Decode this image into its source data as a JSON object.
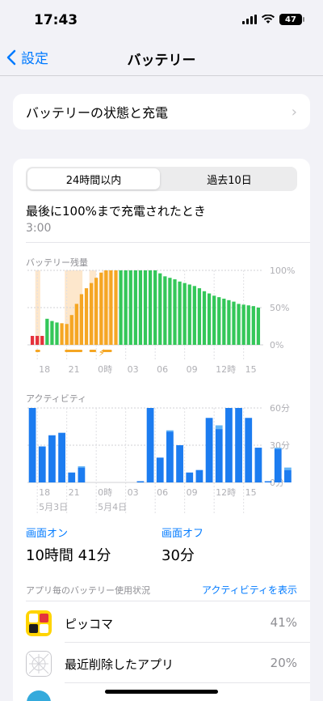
{
  "status": {
    "time": "17:43",
    "battery": "47"
  },
  "nav": {
    "back_label": "設定",
    "title": "バッテリー"
  },
  "health": {
    "label": "バッテリーの状態と充電"
  },
  "segment": {
    "tab_24h": "24時間以内",
    "tab_10d": "過去10日"
  },
  "last_charge": {
    "label": "最後に100%まで充電されたとき",
    "time": "3:00"
  },
  "battery_chart": {
    "title": "バッテリー残量",
    "y_ticks": [
      "100%",
      "50%",
      "0%"
    ],
    "x_ticks": [
      "18",
      "21",
      "0時",
      "03",
      "06",
      "09",
      "12時",
      "15"
    ]
  },
  "activity_chart": {
    "title": "アクティビティ",
    "y_ticks": [
      "60分",
      "30分",
      "0分"
    ],
    "x_ticks": [
      "18",
      "21",
      "0時",
      "03",
      "06",
      "09",
      "12時",
      "15"
    ],
    "dates": [
      "5月3日",
      "5月4日"
    ]
  },
  "screen": {
    "on_label": "画面オン",
    "on_value": "10時間 41分",
    "off_label": "画面オフ",
    "off_value": "30分"
  },
  "usage": {
    "header": "アプリ毎のバッテリー使用状況",
    "link": "アクティビティを表示"
  },
  "apps": [
    {
      "name": "ピッコマ",
      "percent": "41%"
    },
    {
      "name": "最近削除したアプリ",
      "percent": "20%"
    }
  ],
  "chart_data": [
    {
      "type": "bar",
      "title": "バッテリー残量",
      "ylabel": "%",
      "ylim": [
        0,
        100
      ],
      "x_ticks": [
        "18",
        "21",
        "0時",
        "03",
        "06",
        "09",
        "12時",
        "15"
      ],
      "hours": [
        17.5,
        18,
        18.5,
        19,
        19.5,
        20,
        20.5,
        21,
        21.5,
        22,
        22.5,
        23,
        23.5,
        24,
        24.5,
        25,
        25.5,
        26,
        26.5,
        27,
        27.5,
        28,
        28.5,
        29,
        29.5,
        30,
        30.5,
        31,
        31.5,
        32,
        32.5,
        33,
        33.5,
        34,
        34.5,
        35,
        35.5,
        36,
        36.5,
        37,
        37.5,
        38,
        38.5,
        39,
        39.5,
        40,
        40.5
      ],
      "values": [
        12,
        12,
        12,
        35,
        32,
        30,
        29,
        28,
        40,
        55,
        68,
        76,
        83,
        90,
        97,
        100,
        100,
        100,
        100,
        100,
        100,
        100,
        100,
        100,
        100,
        100,
        96,
        92,
        90,
        88,
        85,
        83,
        81,
        79,
        76,
        72,
        69,
        66,
        64,
        62,
        60,
        58,
        55,
        54,
        53,
        52,
        50
      ],
      "series_colors": {
        "low": "#e5323c",
        "charging": "#f5a623",
        "normal": "#34c759"
      },
      "charging_from": 20.5,
      "charging_to": 26.5,
      "low_until": 19,
      "charging_bands": [
        [
          17.8,
          18.3
        ],
        [
          20.8,
          22.6
        ],
        [
          23.3,
          24.0
        ],
        [
          24.6,
          25.6
        ]
      ]
    },
    {
      "type": "bar",
      "title": "アクティビティ",
      "ylabel": "分",
      "ylim": [
        0,
        60
      ],
      "x_ticks": [
        "18",
        "21",
        "0時",
        "03",
        "06",
        "09",
        "12時",
        "15"
      ],
      "series": [
        {
          "name": "画面オン",
          "color": "#1c7cf0",
          "values": [
            60,
            29,
            38,
            40,
            8,
            12,
            0,
            0,
            0,
            0,
            0,
            1,
            60,
            20,
            41,
            30,
            8,
            10,
            52,
            43,
            60,
            60,
            52,
            28,
            1,
            27,
            10
          ]
        },
        {
          "name": "画面オフ",
          "color": "#62b4f6",
          "values": [
            0,
            0,
            0,
            0,
            0,
            1,
            0,
            0,
            0,
            0,
            0,
            0,
            0,
            0,
            1,
            0,
            0,
            0,
            0,
            3,
            0,
            0,
            0,
            0,
            0,
            1,
            2
          ]
        }
      ],
      "x": [
        17.5,
        18.5,
        19.5,
        20.5,
        21.5,
        22.5,
        23.5,
        24.5,
        25.5,
        26.5,
        27.5,
        28.5,
        29.5,
        30.5,
        31.5,
        32.5,
        33.5,
        34.5,
        35.5,
        36.5,
        37.5,
        38.5,
        39.5,
        40.5,
        41.5,
        42.5,
        43.5
      ]
    }
  ]
}
